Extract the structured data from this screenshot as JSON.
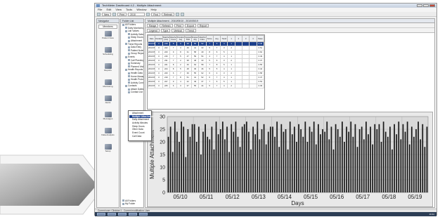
{
  "window": {
    "title": "TechMeter Dashboard 4.2 - Multiple Attachment",
    "controls": [
      "minimize",
      "maximize",
      "close"
    ]
  },
  "menu": [
    "File",
    "Edit",
    "View",
    "Tools",
    "Window",
    "Help"
  ],
  "toolbar": {
    "new_label": "New",
    "print_label": "Print",
    "date_field": "2010",
    "find_label": "Find",
    "refresh_label": "Refresh"
  },
  "nav_pane": {
    "header": "Navigator",
    "button_label": "Members",
    "items": [
      "Patient View",
      "Scheduling",
      "Reports",
      "Monitoring",
      "Alerts",
      "Messages",
      "Data Analysis",
      "Setup"
    ]
  },
  "tree_pane": {
    "header": "Folder List",
    "rows": [
      {
        "label": "All Folders",
        "level": 0
      },
      {
        "label": "Daily Monitoring",
        "level": 1
      },
      {
        "label": "Lab Values",
        "level": 1
      },
      {
        "label": "Activity Data",
        "level": 2
      },
      {
        "label": "Sleep Hours",
        "level": 2
      },
      {
        "label": "Attachment",
        "level": 2
      },
      {
        "label": "Trend Reports",
        "level": 1
      },
      {
        "label": "Data Entry",
        "level": 2
      },
      {
        "label": "Patient Notes",
        "level": 2
      },
      {
        "label": "Group Reports",
        "level": 2
      },
      {
        "label": "Events",
        "level": 1
      },
      {
        "label": "Call Planning",
        "level": 2
      },
      {
        "label": "Summary",
        "level": 2
      },
      {
        "label": "Planned Visits",
        "level": 2
      },
      {
        "label": "Health Reports",
        "level": 1
      },
      {
        "label": "Health Data",
        "level": 2
      },
      {
        "label": "Home Management",
        "level": 2
      },
      {
        "label": "Health Protocols",
        "level": 2
      },
      {
        "label": "Activity Control",
        "level": 2
      },
      {
        "label": "Contacts",
        "level": 1
      },
      {
        "label": "Attach Dates",
        "level": 2
      },
      {
        "label": "Contact List",
        "level": 2
      }
    ],
    "footer_rows": [
      "All Folders",
      "My Folder"
    ]
  },
  "popup_menu": {
    "items": [
      "Attachment",
      "Multiple Attachment",
      "Daily Attachment",
      "Activity Minutes",
      "Sleep Hours",
      "Other Data",
      "Event Count",
      "Call Data"
    ],
    "selected_index": 1
  },
  "content": {
    "doc_tab": "Multiple Attachment - 2010/05/10 - 2010/05/19",
    "toolbar1": [
      "Range",
      "Refresh",
      "Print",
      "Export",
      "Report"
    ],
    "toolbar2": [
      "Legend",
      "Type",
      "Vertical",
      "Trend"
    ],
    "table": {
      "headers": [
        "Date",
        "Duration",
        "Attached (min)",
        "Attached Count",
        "Duration Avg",
        "Frequency Total",
        "Frequency Avg",
        "Attachment Index",
        "Score",
        "Avg",
        "Trend",
        "1",
        "2",
        "3",
        "4",
        "Notes"
      ],
      "rows": [
        [
          "2010/05/10",
          "0",
          "218",
          "8",
          "9",
          "38",
          "55",
          "52",
          "7",
          "5",
          "4",
          "1",
          "",
          "",
          "",
          "0.45"
        ],
        [
          "2010/05/11",
          "0",
          "222",
          "7",
          "3",
          "49",
          "41",
          "33",
          "5",
          "7",
          "3",
          "2",
          "",
          "",
          "",
          "0.51"
        ],
        [
          "2010/05/12",
          "0",
          "220",
          "9",
          "8",
          "31",
          "58",
          "49",
          "8",
          "6",
          "5",
          "1",
          "",
          "",
          "",
          "0.62"
        ],
        [
          "2010/05/13",
          "0",
          "216",
          "7",
          "5",
          "47",
          "59",
          "54",
          "4",
          "7",
          "4",
          "1",
          "",
          "",
          "",
          "0.49"
        ],
        [
          "2010/05/14",
          "0",
          "231",
          "7",
          "2",
          "38",
          "48",
          "33",
          "5",
          "6",
          "3",
          "2",
          "",
          "",
          "",
          "0.37"
        ],
        [
          "2010/05/15",
          "0",
          "221",
          "8",
          "2",
          "46",
          "64",
          "58",
          "7",
          "8",
          "5",
          "1",
          "",
          "",
          "",
          "0.55"
        ],
        [
          "2010/05/16",
          "0",
          "224",
          "8",
          "5",
          "48",
          "39",
          "46",
          "5",
          "5",
          "4",
          "1",
          "",
          "",
          "",
          "0.42"
        ],
        [
          "2010/05/17",
          "0",
          "220",
          "6",
          "7",
          "39",
          "55",
          "62",
          "6",
          "4",
          "3",
          "2",
          "",
          "",
          "",
          "0.58"
        ],
        [
          "2010/05/18",
          "0",
          "219",
          "7",
          "8",
          "51",
          "41",
          "52",
          "6",
          "7",
          "4",
          "1",
          "",
          "",
          "",
          "0.47"
        ],
        [
          "2010/05/19",
          "0",
          "227",
          "9",
          "4",
          "42",
          "49",
          "37",
          "7",
          "6",
          "5",
          "1",
          "",
          "",
          "",
          "0.53"
        ],
        [
          "2010/05/20",
          "0",
          "225",
          "6",
          "3",
          "37",
          "55",
          "44",
          "5",
          "7",
          "4",
          "2",
          "",
          "",
          "",
          "0.39"
        ]
      ]
    }
  },
  "chart_data": {
    "type": "bar",
    "title": "",
    "xlabel": "Days",
    "ylabel": "Multiple Attachment",
    "ylim": [
      0,
      30
    ],
    "yticks": [
      0,
      5,
      10,
      15,
      20,
      25,
      30
    ],
    "categories": [
      "05/10",
      "05/11",
      "05/12",
      "05/13",
      "05/14",
      "05/15",
      "05/16",
      "05/17",
      "05/18",
      "05/19"
    ],
    "grid": true,
    "legend": "none",
    "series": [
      {
        "color": "#1a1a1a",
        "values": [
          [
            22,
            26,
            16,
            28,
            24,
            20,
            28,
            26,
            14,
            25,
            22,
            27
          ],
          [
            27,
            20,
            26,
            15,
            24,
            27,
            22,
            21,
            26,
            17,
            28,
            23
          ],
          [
            25,
            28,
            21,
            26,
            16,
            27,
            24,
            28,
            22,
            18,
            26,
            27
          ],
          [
            28,
            24,
            17,
            26,
            23,
            28,
            21,
            25,
            27,
            19,
            24,
            26
          ],
          [
            26,
            22,
            28,
            18,
            27,
            24,
            25,
            17,
            28,
            23,
            26,
            20
          ],
          [
            27,
            25,
            22,
            28,
            20,
            26,
            24,
            28,
            19,
            27,
            23,
            25
          ],
          [
            24,
            28,
            21,
            26,
            17,
            27,
            25,
            22,
            28,
            20,
            26,
            24
          ],
          [
            28,
            22,
            27,
            18,
            25,
            26,
            21,
            28,
            23,
            26,
            19,
            27
          ],
          [
            25,
            27,
            20,
            28,
            24,
            22,
            26,
            17,
            27,
            23,
            28,
            21
          ],
          [
            27,
            24,
            28,
            19,
            26,
            22,
            25,
            28,
            21,
            27,
            18,
            26
          ]
        ]
      }
    ]
  },
  "status_bar": "Current user: Clinician 1 - Current modification: User",
  "taskbar_clock": "10:42"
}
